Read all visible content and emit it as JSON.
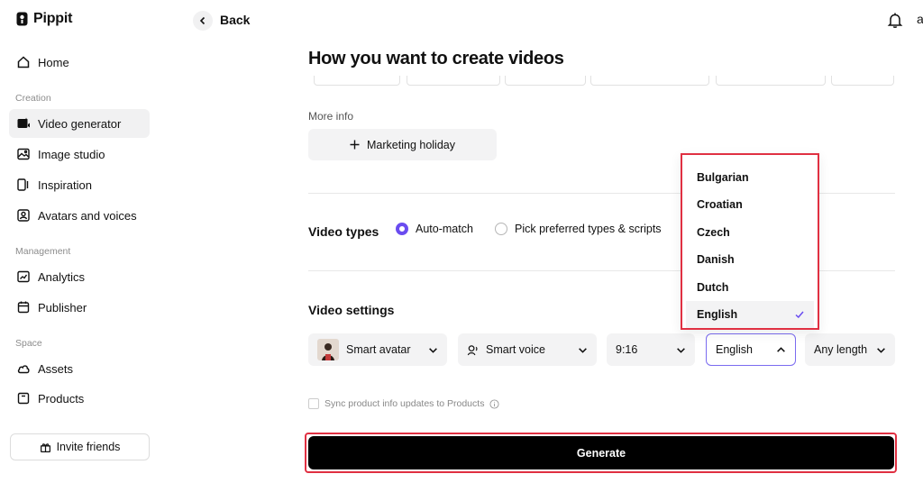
{
  "app": {
    "name": "Pippit"
  },
  "topbar": {
    "back_label": "Back",
    "avatar_initial": "a"
  },
  "sidebar": {
    "home": "Home",
    "sections": {
      "creation": "Creation",
      "management": "Management",
      "space": "Space"
    },
    "creation_items": [
      "Video generator",
      "Image studio",
      "Inspiration",
      "Avatars and voices"
    ],
    "management_items": [
      "Analytics",
      "Publisher"
    ],
    "space_items": [
      "Assets",
      "Products"
    ],
    "invite_label": "Invite friends"
  },
  "main": {
    "title": "How you want to create videos",
    "more_info_label": "More info",
    "marketing_button": "Marketing holiday",
    "video_types": {
      "label": "Video types",
      "options": [
        "Auto-match",
        "Pick preferred types & scripts"
      ],
      "selected": "Auto-match"
    },
    "video_settings": {
      "label": "Video settings",
      "avatar": "Smart avatar",
      "voice": "Smart voice",
      "ratio": "9:16",
      "language": "English",
      "length": "Any length"
    },
    "sync_label": "Sync product info updates to Products",
    "generate_label": "Generate"
  },
  "language_dropdown": {
    "options": [
      "Bulgarian",
      "Croatian",
      "Czech",
      "Danish",
      "Dutch",
      "English"
    ],
    "selected": "English"
  },
  "colors": {
    "accent": "#6a4cf0",
    "highlight_outline": "#e03042",
    "generate_bg": "#000000"
  }
}
